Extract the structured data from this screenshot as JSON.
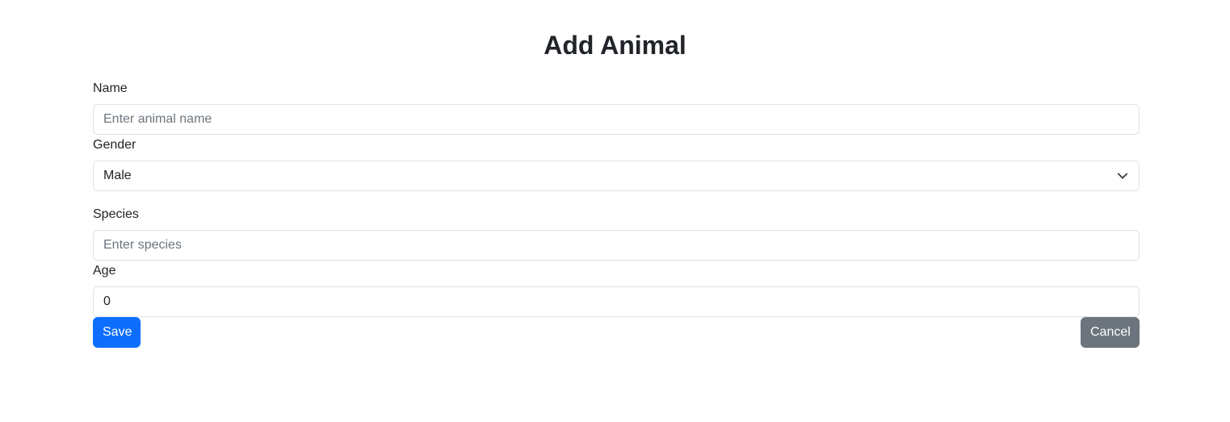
{
  "page": {
    "title": "Add Animal"
  },
  "form": {
    "name": {
      "label": "Name",
      "value": "",
      "placeholder": "Enter animal name"
    },
    "gender": {
      "label": "Gender",
      "selected": "Male",
      "icon": "chevron-down-icon"
    },
    "species": {
      "label": "Species",
      "value": "",
      "placeholder": "Enter species"
    },
    "age": {
      "label": "Age",
      "value": "0"
    }
  },
  "actions": {
    "save_label": "Save",
    "cancel_label": "Cancel"
  },
  "colors": {
    "primary": "#0d6efd",
    "secondary": "#6c757d",
    "border": "#dee2e6",
    "text": "#212529"
  }
}
